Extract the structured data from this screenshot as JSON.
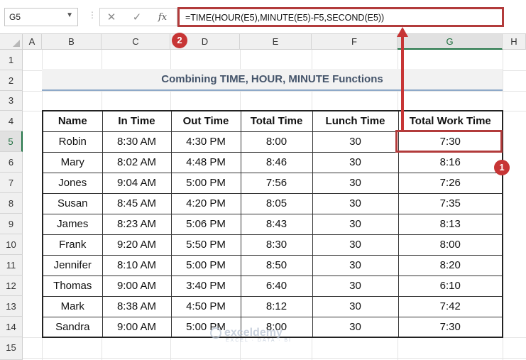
{
  "formula_bar": {
    "name_box": "G5",
    "cancel_icon": "✕",
    "enter_icon": "✓",
    "fx_label": "fx",
    "formula": "=TIME(HOUR(E5),MINUTE(E5)-F5,SECOND(E5))"
  },
  "columns": [
    "A",
    "B",
    "C",
    "D",
    "E",
    "F",
    "G",
    "H"
  ],
  "rows": [
    "1",
    "2",
    "3",
    "4",
    "5",
    "6",
    "7",
    "8",
    "9",
    "10",
    "11",
    "12",
    "13",
    "14",
    "15"
  ],
  "selected_cell": {
    "column": "G",
    "row": "5"
  },
  "title": "Combining TIME, HOUR, MINUTE Functions",
  "table": {
    "headers": [
      "Name",
      "In Time",
      "Out Time",
      "Total Time",
      "Lunch Time",
      "Total Work Time"
    ],
    "rows": [
      [
        "Robin",
        "8:30 AM",
        "4:30 PM",
        "8:00",
        "30",
        "7:30"
      ],
      [
        "Mary",
        "8:02 AM",
        "4:48 PM",
        "8:46",
        "30",
        "8:16"
      ],
      [
        "Jones",
        "9:04 AM",
        "5:00 PM",
        "7:56",
        "30",
        "7:26"
      ],
      [
        "Susan",
        "8:45 AM",
        "4:20 PM",
        "8:05",
        "30",
        "7:35"
      ],
      [
        "James",
        "8:23 AM",
        "5:06 PM",
        "8:43",
        "30",
        "8:13"
      ],
      [
        "Frank",
        "9:20 AM",
        "5:50 PM",
        "8:30",
        "30",
        "8:00"
      ],
      [
        "Jennifer",
        "8:10 AM",
        "5:00 PM",
        "8:50",
        "30",
        "8:20"
      ],
      [
        "Thomas",
        "9:00 AM",
        "3:40 PM",
        "6:40",
        "30",
        "6:10"
      ],
      [
        "Mark",
        "8:38 AM",
        "4:50 PM",
        "8:12",
        "30",
        "7:42"
      ],
      [
        "Sandra",
        "9:00 AM",
        "5:00 PM",
        "8:00",
        "30",
        "7:30"
      ]
    ]
  },
  "annotations": {
    "badge_1": "1",
    "badge_2": "2",
    "color": "#c73535"
  },
  "watermark": {
    "name": "exceldemy",
    "tagline": "EXCEL · DATA · BI"
  }
}
